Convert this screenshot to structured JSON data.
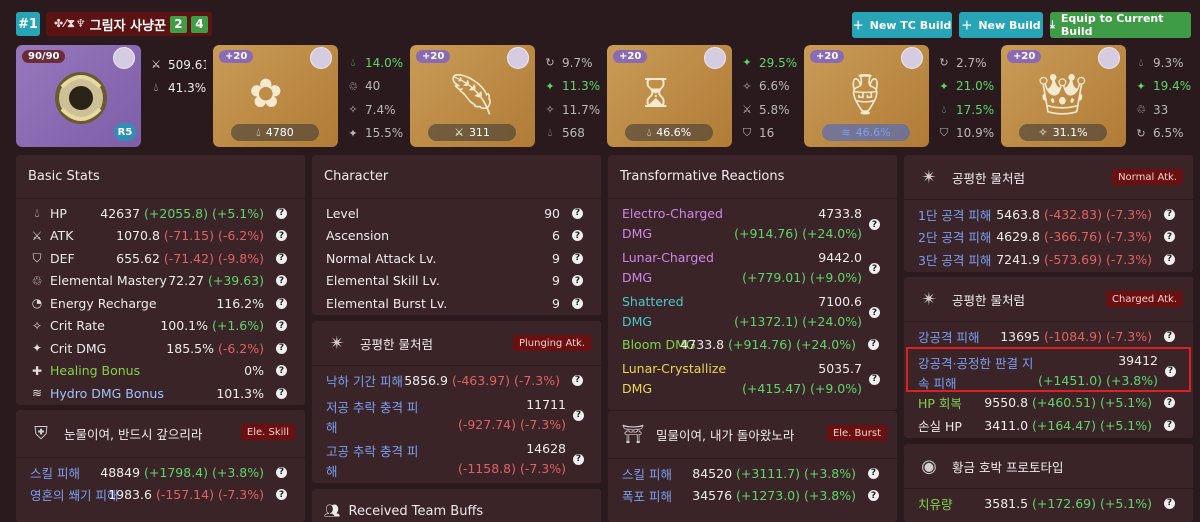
{
  "header": {
    "build_number": "#1",
    "build_name": "그림자 사냥꾼",
    "set_counts": [
      "2",
      "4"
    ],
    "buttons": {
      "new_tc": "New TC Build",
      "new_build": "New Build",
      "equip": "Equip to Current Build"
    },
    "colors": {
      "new_tc": "#27a4b5",
      "new_build": "#27a4b5",
      "equip": "#3e9b46"
    }
  },
  "weapon": {
    "level": "90/90",
    "refine": "R5",
    "atk": "509.61",
    "sub": "41.3%"
  },
  "artifacts": [
    {
      "level": "+20",
      "main": "4780",
      "main_icon": "hp-icon",
      "subs": [
        "14.0%",
        "40",
        "7.4%",
        "15.5%"
      ],
      "sub_hi": [
        true,
        false,
        false,
        false
      ]
    },
    {
      "level": "+20",
      "main": "311",
      "main_icon": "atk-icon",
      "subs": [
        "9.7%",
        "11.3%",
        "11.7%",
        "568"
      ],
      "sub_hi": [
        false,
        true,
        false,
        false
      ]
    },
    {
      "level": "+20",
      "main": "46.6%",
      "main_icon": "hp-icon",
      "subs": [
        "29.5%",
        "6.6%",
        "5.8%",
        "16"
      ],
      "sub_hi": [
        true,
        false,
        false,
        false
      ]
    },
    {
      "level": "+20",
      "main": "46.6%",
      "main_icon": "hydro-icon",
      "subs": [
        "2.7%",
        "21.0%",
        "17.5%",
        "10.9%"
      ],
      "sub_hi": [
        false,
        true,
        true,
        false
      ]
    },
    {
      "level": "+20",
      "main": "31.1%",
      "main_icon": "crit-icon",
      "subs": [
        "9.3%",
        "19.4%",
        "33",
        "6.5%"
      ],
      "sub_hi": [
        false,
        true,
        false,
        false
      ]
    }
  ],
  "basic_stats": {
    "title": "Basic Stats",
    "rows": [
      {
        "label": "HP",
        "value": "42637",
        "bonus": "(+2055.8)",
        "pct": "(+5.1%)",
        "tone": "g"
      },
      {
        "label": "ATK",
        "value": "1070.8",
        "bonus": "(-71.15)",
        "pct": "(-6.2%)",
        "tone": "r"
      },
      {
        "label": "DEF",
        "value": "655.62",
        "bonus": "(-71.42)",
        "pct": "(-9.8%)",
        "tone": "r"
      },
      {
        "label": "Elemental Mastery",
        "value": "72.27",
        "bonus": "(+39.63)",
        "pct": "",
        "tone": "g"
      },
      {
        "label": "Energy Recharge",
        "value": "116.2%",
        "bonus": "",
        "pct": "",
        "tone": "g"
      },
      {
        "label": "Crit Rate",
        "value": "100.1%",
        "bonus": "(+1.6%)",
        "pct": "",
        "tone": "g"
      },
      {
        "label": "Crit DMG",
        "value": "185.5%",
        "bonus": "(-6.2%)",
        "pct": "",
        "tone": "r"
      },
      {
        "label": "Healing Bonus",
        "value": "0%",
        "bonus": "",
        "pct": "",
        "tone": "g"
      },
      {
        "label": "Hydro DMG Bonus",
        "value": "101.3%",
        "bonus": "",
        "pct": "",
        "tone": "g"
      }
    ]
  },
  "skill_panel": {
    "title": "눈물이여, 반드시 갚으리라",
    "tag": "Ele. Skill",
    "rows": [
      {
        "label": "스킬 피해",
        "value": "48849",
        "bonus": "(+1798.4)",
        "pct": "(+3.8%)",
        "tone": "g"
      },
      {
        "label": "영혼의 쐐기 피해",
        "value": "1983.6",
        "bonus": "(-157.14)",
        "pct": "(-7.3%)",
        "tone": "r"
      }
    ]
  },
  "character": {
    "title": "Character",
    "rows": [
      {
        "label": "Level",
        "value": "90"
      },
      {
        "label": "Ascension",
        "value": "6"
      },
      {
        "label": "Normal Attack Lv.",
        "value": "9"
      },
      {
        "label": "Elemental Skill Lv.",
        "value": "9"
      },
      {
        "label": "Elemental Burst Lv.",
        "value": "9"
      }
    ]
  },
  "plunging_panel": {
    "title": "공평한 물처럼",
    "tag": "Plunging Atk.",
    "row1": {
      "label": "낙하 기간 피해",
      "value": "5856.9",
      "bonus": "(-463.97)",
      "pct": "(-7.3%)"
    },
    "row2": {
      "label_a": "저공 추락 충격 피",
      "label_b": "해",
      "value": "11711",
      "bonus": "(-927.74)",
      "pct": "(-7.3%)"
    },
    "row3": {
      "label_a": "고공 추락 충격 피",
      "label_b": "해",
      "value": "14628",
      "bonus": "(-1158.8)",
      "pct": "(-7.3%)"
    }
  },
  "team_buffs": {
    "title": "Received Team Buffs"
  },
  "reactions": {
    "title": "Transformative Reactions",
    "electro": {
      "label_a": "Electro-Charged",
      "label_b": "DMG",
      "value": "4733.8",
      "bonus": "(+914.76)",
      "pct": "(+24.0%)"
    },
    "lunar": {
      "label_a": "Lunar-Charged",
      "label_b": "DMG",
      "value": "9442.0",
      "bonus": "(+779.01)",
      "pct": "(+9.0%)"
    },
    "shattered": {
      "label_a": "Shattered",
      "label_b": "DMG",
      "value": "7100.6",
      "bonus": "(+1372.1)",
      "pct": "(+24.0%)"
    },
    "bloom": {
      "label": "Bloom DMG",
      "value": "4733.8",
      "bonus": "(+914.76)",
      "pct": "(+24.0%)"
    },
    "crystallize": {
      "label_a": "Lunar-Crystallize",
      "label_b": "DMG",
      "value": "5035.7",
      "bonus": "(+415.47)",
      "pct": "(+9.0%)"
    }
  },
  "burst_panel": {
    "title": "밀물이여, 내가 돌아왔노라",
    "tag": "Ele. Burst",
    "rows": [
      {
        "label": "스킬 피해",
        "value": "84520",
        "bonus": "(+3111.7)",
        "pct": "(+3.8%)"
      },
      {
        "label": "폭포 피해",
        "value": "34576",
        "bonus": "(+1273.0)",
        "pct": "(+3.8%)"
      }
    ]
  },
  "normal_panel": {
    "title": "공평한 물처럼",
    "tag": "Normal Atk.",
    "rows": [
      {
        "label": "1단 공격 피해",
        "value": "5463.8",
        "bonus": "(-432.83)",
        "pct": "(-7.3%)"
      },
      {
        "label": "2단 공격 피해",
        "value": "4629.8",
        "bonus": "(-366.76)",
        "pct": "(-7.3%)"
      },
      {
        "label": "3단 공격 피해",
        "value": "7241.9",
        "bonus": "(-573.69)",
        "pct": "(-7.3%)"
      }
    ]
  },
  "charged_panel": {
    "title": "공평한 물처럼",
    "tag": "Charged Atk.",
    "row1": {
      "label": "강공격 피해",
      "value": "13695",
      "bonus": "(-1084.9)",
      "pct": "(-7.3%)"
    },
    "row2": {
      "label_a": "강공격·공정한 판결 지",
      "label_b": "속 피해",
      "value": "39412",
      "bonus": "(+1451.0)",
      "pct": "(+3.8%)"
    },
    "row3": {
      "label": "HP 회복",
      "value": "9550.8",
      "bonus": "(+460.51)",
      "pct": "(+5.1%)"
    },
    "row4": {
      "label": "손실 HP",
      "value": "3411.0",
      "bonus": "(+164.47)",
      "pct": "(+5.1%)"
    }
  },
  "amber_panel": {
    "title": "황금 호박 프로토타입",
    "row1": {
      "label": "치유량",
      "value": "3581.5",
      "bonus": "(+172.69)",
      "pct": "(+5.1%)"
    }
  }
}
